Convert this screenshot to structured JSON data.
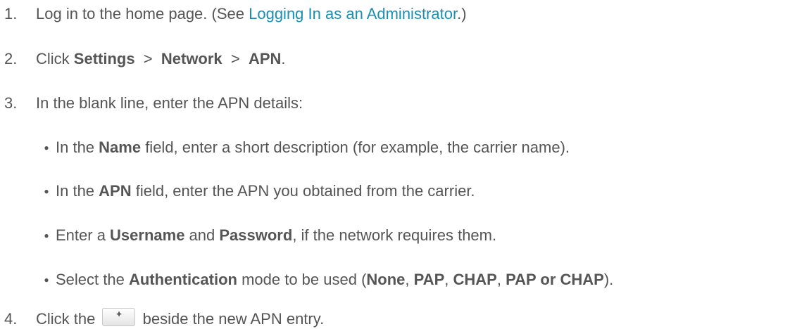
{
  "steps": [
    {
      "num": "1.",
      "a": "Log in to the home page. (See ",
      "link": "Logging In as an Administrator",
      "b": ".)"
    },
    {
      "num": "2.",
      "a": "Click ",
      "b1": "Settings",
      "sep1": "  >  ",
      "b2": "Network",
      "sep2": "  >  ",
      "b3": "APN",
      "end": "."
    },
    {
      "num": "3.",
      "text": "In the blank line, enter the APN details:"
    },
    {
      "num": "4.",
      "a": "Click the ",
      "btn": "+",
      "b": " beside the new APN entry."
    }
  ],
  "bullets": [
    {
      "a": "In the ",
      "b1": "Name",
      "c": " field, enter a short description (for example, the carrier name)."
    },
    {
      "a": "In the ",
      "b1": "APN",
      "c": " field, enter the APN you obtained from the carrier."
    },
    {
      "a": "Enter a ",
      "b1": "Username",
      "c": " and ",
      "b2": "Password",
      "d": ", if the network requires them."
    },
    {
      "a": "Select the ",
      "b1": "Authentication",
      "c": " mode to be used (",
      "b2": "None",
      "s1": ", ",
      "b3": "PAP",
      "s2": ", ",
      "b4": "CHAP",
      "s3": ", ",
      "b5": "PAP or CHAP",
      "d": ")."
    }
  ],
  "bullet_glyph": "●",
  "colors": {
    "text": "#555555",
    "link": "#1a8fb5"
  }
}
